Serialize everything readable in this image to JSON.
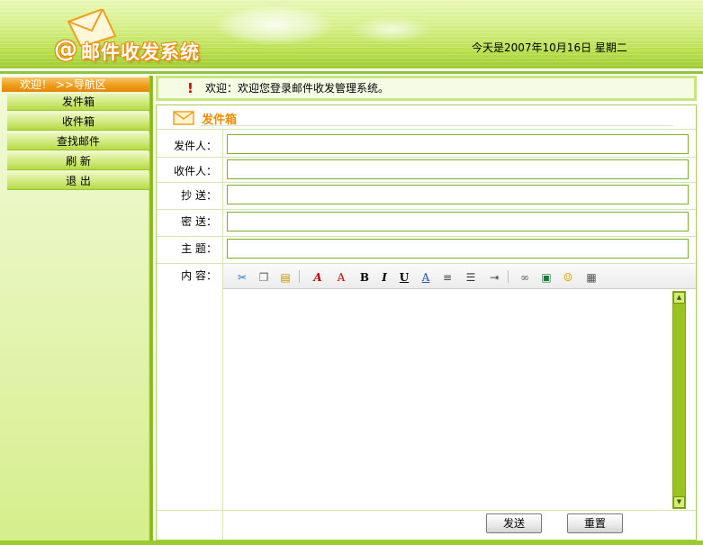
{
  "header": {
    "logo_text": "邮件收发系统",
    "logo_at": "@",
    "date_text": "今天是2007年10月16日  星期二"
  },
  "sidebar": {
    "title": "欢迎！ >>导航区",
    "items": [
      {
        "label": "发件箱"
      },
      {
        "label": "收件箱"
      },
      {
        "label": "查找邮件"
      },
      {
        "label": "刷 新"
      },
      {
        "label": "退 出"
      }
    ]
  },
  "notice": {
    "text": "欢迎：欢迎您登录邮件收发管理系统。"
  },
  "panel": {
    "title": "发件箱",
    "fields": [
      {
        "label": "发件人：",
        "value": ""
      },
      {
        "label": "收件人：",
        "value": ""
      },
      {
        "label": "抄 送：",
        "value": ""
      },
      {
        "label": "密 送：",
        "value": ""
      },
      {
        "label": "主 题：",
        "value": ""
      }
    ],
    "content_label": "内 容：",
    "send_label": "发送",
    "reset_label": "重置"
  },
  "toolbar_icons": [
    "cut-icon",
    "copy-icon",
    "paste-icon",
    "font-color-icon",
    "font-size-icon",
    "bold-icon",
    "italic-icon",
    "underline-icon",
    "text-color-icon",
    "align-icon",
    "ordered-list-icon",
    "indent-icon",
    "link-icon",
    "image-icon",
    "emoticon-icon",
    "table-icon"
  ],
  "colors": {
    "accent_orange": "#f08c00",
    "green": "#9acc2e",
    "border_green": "#7fb02a"
  }
}
